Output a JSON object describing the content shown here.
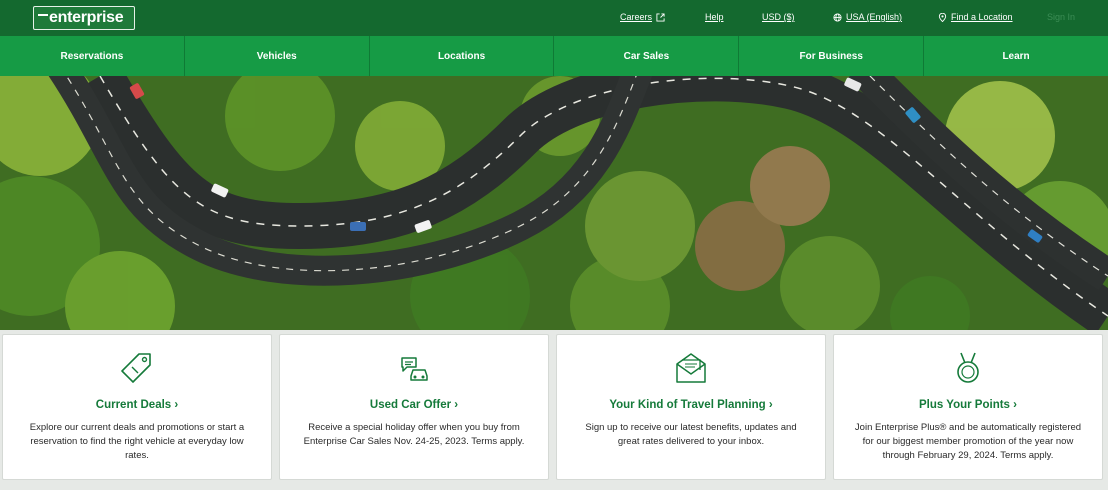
{
  "brand": {
    "logo_text": "enterprise"
  },
  "utility_nav": {
    "careers": "Careers",
    "help": "Help",
    "currency": "USD ($)",
    "language": "USA (English)",
    "find_location": "Find a Location",
    "sign_in": "Sign In"
  },
  "main_nav": [
    "Reservations",
    "Vehicles",
    "Locations",
    "Car Sales",
    "For Business",
    "Learn"
  ],
  "cards": [
    {
      "title": "Current Deals ›",
      "description": "Explore our current deals and promotions or start a reservation to find the right vehicle at everyday low rates.",
      "icon": "price-tag-icon"
    },
    {
      "title": "Used Car Offer ›",
      "description": "Receive a special holiday offer when you buy from Enterprise Car Sales Nov. 24-25, 2023. Terms apply.",
      "icon": "used-car-chat-icon"
    },
    {
      "title": "Your Kind of Travel Planning ›",
      "description": "Sign up to receive our latest benefits, updates and great rates delivered to your inbox.",
      "icon": "mail-envelope-icon"
    },
    {
      "title": "Plus Your Points ›",
      "description": "Join Enterprise Plus® and be automatically registered for our biggest member promotion of the year now through February 29, 2024. Terms apply.",
      "icon": "medal-icon"
    }
  ],
  "colors": {
    "header_dark": "#14692f",
    "nav_green": "#169b45",
    "accent_text": "#157a3a"
  }
}
